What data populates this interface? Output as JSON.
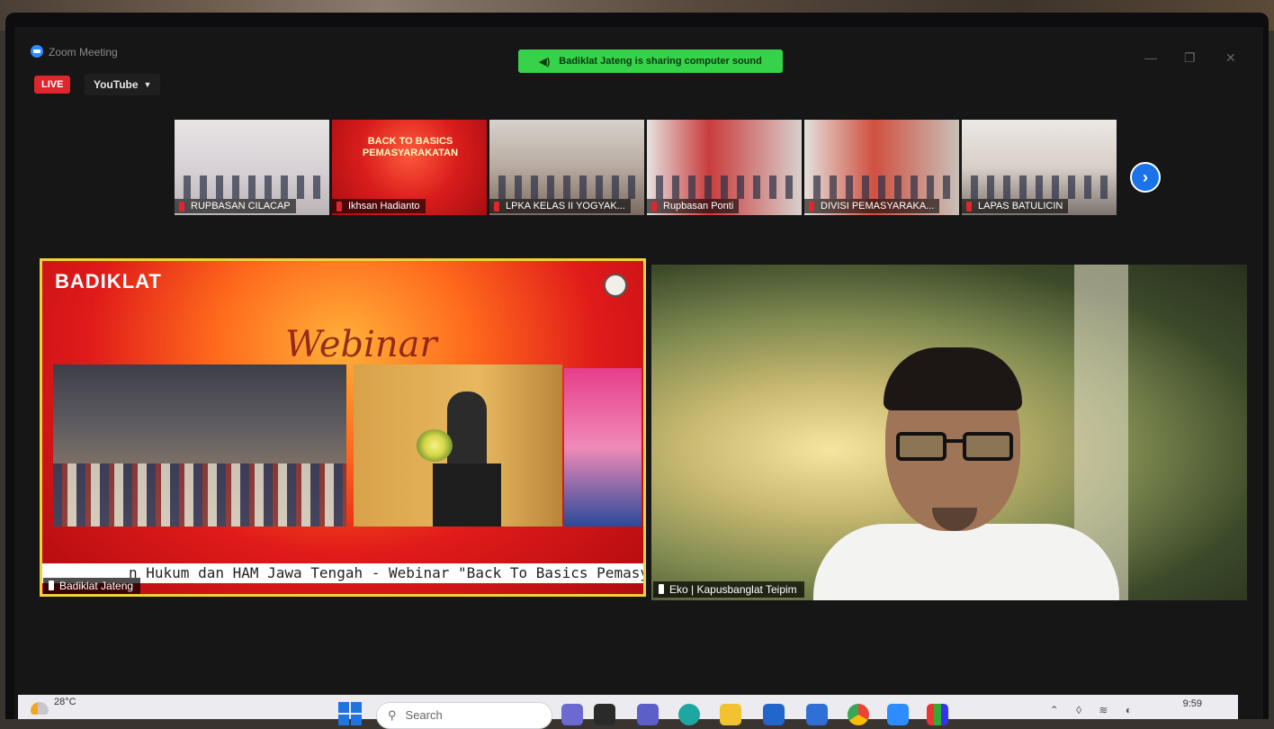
{
  "window": {
    "app_title": "Zoom Meeting",
    "share_banner": "Badiklat Jateng is sharing computer sound",
    "live_badge": "LIVE",
    "stream_target": "YouTube"
  },
  "thumbnails": [
    {
      "name": "RUPBASAN CILACAP"
    },
    {
      "name": "Ikhsan Hadianto",
      "poster": "BACK TO BASICS PEMASYARAKATAN"
    },
    {
      "name": "LPKA KELAS II YOGYAK..."
    },
    {
      "name": "Rupbasan Ponti"
    },
    {
      "name": "DIVISI PEMASYARAKA..."
    },
    {
      "name": "LAPAS BATULICIN"
    }
  ],
  "main": {
    "left_tile": {
      "logo": "BADIKLAT",
      "script_title": "Webinar",
      "ticker": "n Hukum dan HAM Jawa Tengah - Webinar \"Back To Basics Pemasyara",
      "label": "Badiklat Jateng"
    },
    "right_tile": {
      "label": "Eko | Kapusbanglat Teipim"
    }
  },
  "taskbar": {
    "weather_temp": "28°C",
    "search_placeholder": "Search",
    "clock": "9:59"
  },
  "icons": {
    "zoom_logo": "zoom-logo-icon",
    "speaker": "speaker-icon",
    "next_page": "chevron-right-icon",
    "start": "windows-start-icon",
    "search": "search-icon"
  },
  "colors": {
    "live_red": "#e0262d",
    "share_green": "#35d24a",
    "active_speaker_border": "#f0d338",
    "zoom_blue": "#2d8cff"
  }
}
